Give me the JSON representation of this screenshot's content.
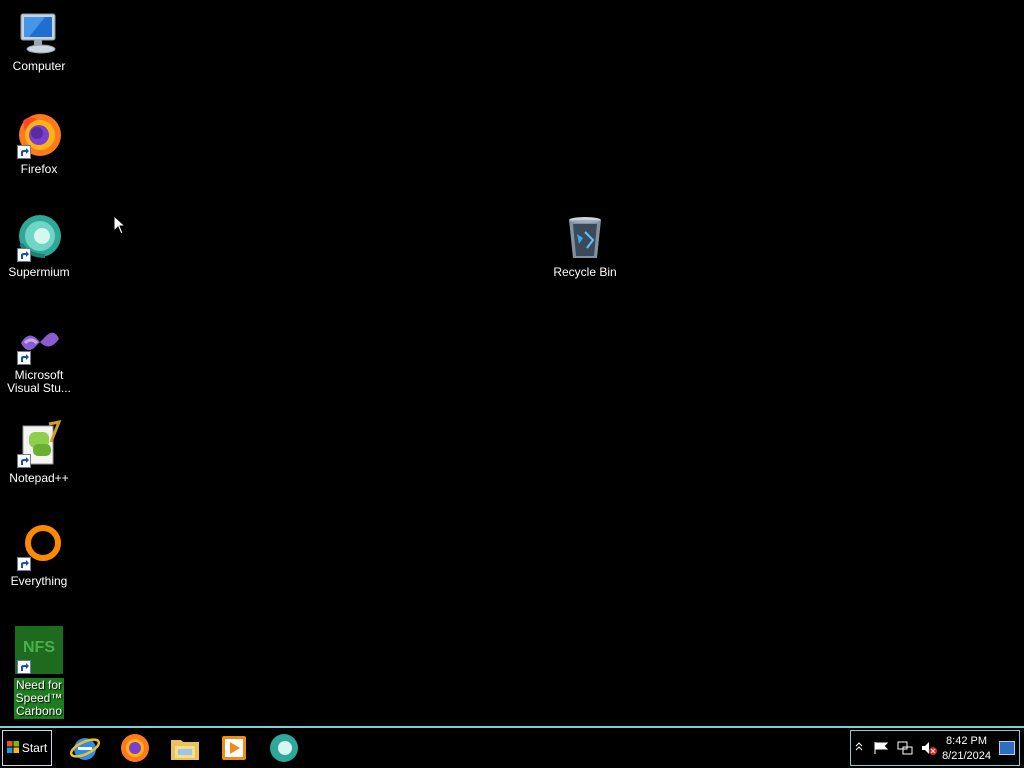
{
  "desktop": {
    "icons": [
      {
        "label": "Computer"
      },
      {
        "label": "Firefox"
      },
      {
        "label": "Supermium"
      },
      {
        "label_line1": "Microsoft",
        "label_line2": "Visual Stu..."
      },
      {
        "label": "Notepad++"
      },
      {
        "label": "Everything"
      },
      {
        "label_line1": "Need for",
        "label_line2": "Speed™",
        "label_line3": "Carbono"
      },
      {
        "label": "Recycle Bin"
      }
    ]
  },
  "taskbar": {
    "start_label": "Start",
    "pinned": [
      "internet-explorer-icon",
      "firefox-icon",
      "file-explorer-icon",
      "media-player-icon",
      "supermium-icon"
    ],
    "clock_time": "8:42 PM",
    "clock_date": "8/21/2024"
  },
  "colors": {
    "desktop_bg": "#000000",
    "taskbar_border": "#7fd0d6",
    "selection": "#1e7d1e"
  }
}
